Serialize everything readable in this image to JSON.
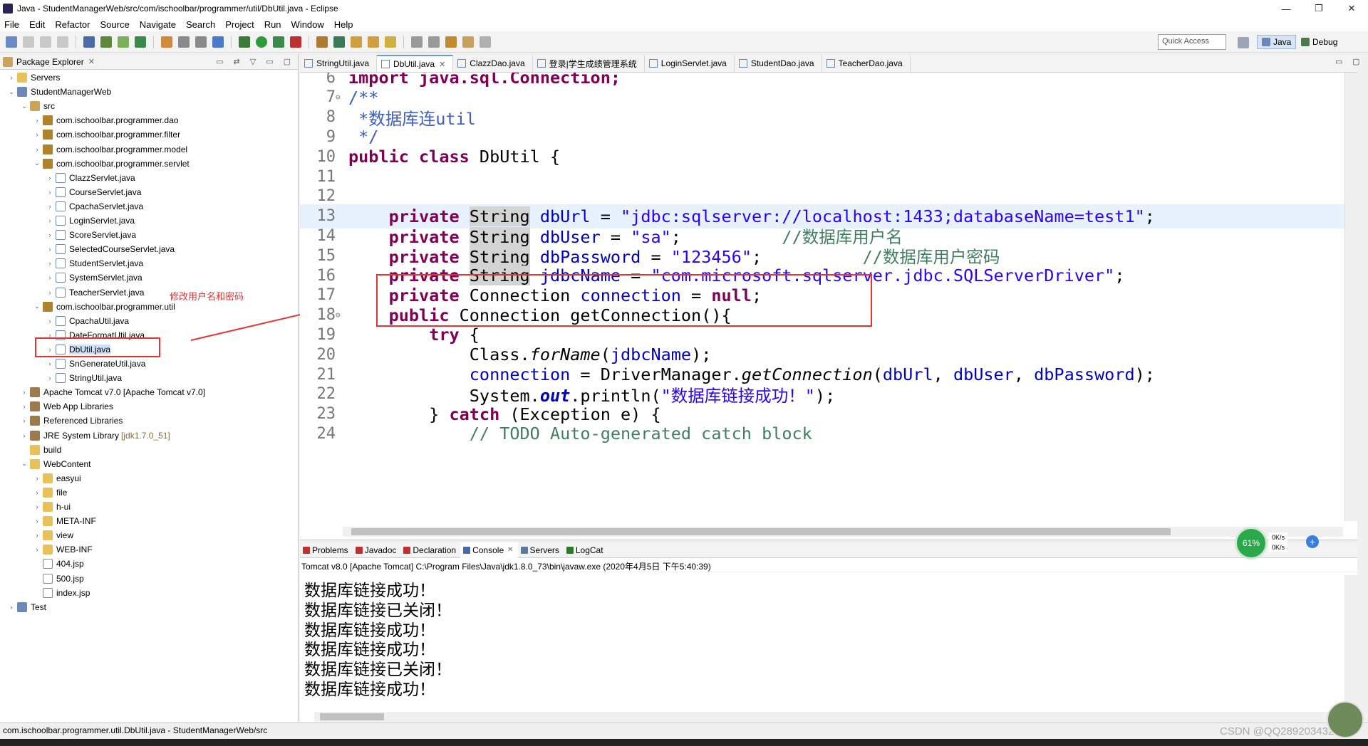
{
  "window": {
    "title": "Java - StudentManagerWeb/src/com/ischoolbar/programmer/util/DbUtil.java - Eclipse",
    "minimize": "—",
    "maximize": "❐",
    "close": "✕"
  },
  "menu": [
    "File",
    "Edit",
    "Refactor",
    "Source",
    "Navigate",
    "Search",
    "Project",
    "Run",
    "Window",
    "Help"
  ],
  "toolbar": {
    "quick_access": "Quick Access",
    "perspective_java": "Java",
    "perspective_debug": "Debug"
  },
  "package_explorer": {
    "tab_label": "Package Explorer",
    "tree": [
      {
        "label": "Servers",
        "icon": "folder-icon",
        "depth": 0,
        "arrow": "›"
      },
      {
        "label": "StudentManagerWeb",
        "icon": "project-icon",
        "depth": 0,
        "arrow": "⌄"
      },
      {
        "label": "src",
        "icon": "source-folder-icon",
        "depth": 1,
        "arrow": "⌄"
      },
      {
        "label": "com.ischoolbar.programmer.dao",
        "icon": "package-icon",
        "depth": 2,
        "arrow": "›"
      },
      {
        "label": "com.ischoolbar.programmer.filter",
        "icon": "package-icon",
        "depth": 2,
        "arrow": "›"
      },
      {
        "label": "com.ischoolbar.programmer.model",
        "icon": "package-icon",
        "depth": 2,
        "arrow": "›"
      },
      {
        "label": "com.ischoolbar.programmer.servlet",
        "icon": "package-icon",
        "depth": 2,
        "arrow": "⌄"
      },
      {
        "label": "ClazzServlet.java",
        "icon": "java-file-icon",
        "depth": 3,
        "arrow": "›"
      },
      {
        "label": "CourseServlet.java",
        "icon": "java-file-icon",
        "depth": 3,
        "arrow": "›"
      },
      {
        "label": "CpachaServlet.java",
        "icon": "java-file-icon",
        "depth": 3,
        "arrow": "›"
      },
      {
        "label": "LoginServlet.java",
        "icon": "java-file-icon",
        "depth": 3,
        "arrow": "›"
      },
      {
        "label": "ScoreServlet.java",
        "icon": "java-file-icon",
        "depth": 3,
        "arrow": "›"
      },
      {
        "label": "SelectedCourseServlet.java",
        "icon": "java-file-icon",
        "depth": 3,
        "arrow": "›"
      },
      {
        "label": "StudentServlet.java",
        "icon": "java-file-icon",
        "depth": 3,
        "arrow": "›"
      },
      {
        "label": "SystemServlet.java",
        "icon": "java-file-icon",
        "depth": 3,
        "arrow": "›"
      },
      {
        "label": "TeacherServlet.java",
        "icon": "java-file-icon",
        "depth": 3,
        "arrow": "›"
      },
      {
        "label": "com.ischoolbar.programmer.util",
        "icon": "package-icon",
        "depth": 2,
        "arrow": "⌄"
      },
      {
        "label": "CpachaUtil.java",
        "icon": "java-file-icon",
        "depth": 3,
        "arrow": "›"
      },
      {
        "label": "DateFormatUtil.java",
        "icon": "java-file-icon",
        "depth": 3,
        "arrow": "›"
      },
      {
        "label": "DbUtil.java",
        "icon": "java-file-icon",
        "depth": 3,
        "arrow": "›",
        "selected": true
      },
      {
        "label": "SnGenerateUtil.java",
        "icon": "java-file-icon",
        "depth": 3,
        "arrow": "›"
      },
      {
        "label": "StringUtil.java",
        "icon": "java-file-icon",
        "depth": 3,
        "arrow": "›"
      },
      {
        "label": "Apache Tomcat v7.0 [Apache Tomcat v7.0]",
        "icon": "library-icon",
        "depth": 1,
        "arrow": "›"
      },
      {
        "label": "Web App Libraries",
        "icon": "library-icon",
        "depth": 1,
        "arrow": "›"
      },
      {
        "label": "Referenced Libraries",
        "icon": "library-icon",
        "depth": 1,
        "arrow": "›"
      },
      {
        "label": "JRE System Library",
        "suffix": "[jdk1.7.0_51]",
        "icon": "library-icon",
        "depth": 1,
        "arrow": "›"
      },
      {
        "label": "build",
        "icon": "folder-icon",
        "depth": 1,
        "arrow": ""
      },
      {
        "label": "WebContent",
        "icon": "folder-icon",
        "depth": 1,
        "arrow": "⌄"
      },
      {
        "label": "easyui",
        "icon": "folder-icon",
        "depth": 2,
        "arrow": "›"
      },
      {
        "label": "file",
        "icon": "folder-icon",
        "depth": 2,
        "arrow": "›"
      },
      {
        "label": "h-ui",
        "icon": "folder-icon",
        "depth": 2,
        "arrow": "›"
      },
      {
        "label": "META-INF",
        "icon": "folder-icon",
        "depth": 2,
        "arrow": "›"
      },
      {
        "label": "view",
        "icon": "folder-icon",
        "depth": 2,
        "arrow": "›"
      },
      {
        "label": "WEB-INF",
        "icon": "folder-icon",
        "depth": 2,
        "arrow": "›"
      },
      {
        "label": "404.jsp",
        "icon": "jsp-file-icon",
        "depth": 2,
        "arrow": ""
      },
      {
        "label": "500.jsp",
        "icon": "jsp-file-icon",
        "depth": 2,
        "arrow": ""
      },
      {
        "label": "index.jsp",
        "icon": "jsp-file-icon",
        "depth": 2,
        "arrow": ""
      },
      {
        "label": "Test",
        "icon": "project-icon",
        "depth": 0,
        "arrow": "›"
      }
    ]
  },
  "annotation": {
    "text": "修改用户名和密码"
  },
  "editor": {
    "tabs": [
      {
        "label": "StringUtil.java",
        "active": false
      },
      {
        "label": "DbUtil.java",
        "active": true
      },
      {
        "label": "ClazzDao.java",
        "active": false
      },
      {
        "label": "登录|学生成绩管理系统",
        "active": false
      },
      {
        "label": "LoginServlet.java",
        "active": false
      },
      {
        "label": "StudentDao.java",
        "active": false
      },
      {
        "label": "TeacherDao.java",
        "active": false
      }
    ],
    "lines": [
      {
        "no": "6",
        "tokens": [
          {
            "t": "import java.sql.Connection;",
            "c": "kw"
          }
        ]
      },
      {
        "no": "7",
        "fold": true,
        "tokens": [
          {
            "t": "/**",
            "c": "doc"
          }
        ]
      },
      {
        "no": "8",
        "tokens": [
          {
            "t": " *数据库连util",
            "c": "doc"
          }
        ]
      },
      {
        "no": "9",
        "tokens": [
          {
            "t": " */",
            "c": "doc"
          }
        ]
      },
      {
        "no": "10",
        "tokens": [
          {
            "t": "public class",
            "c": "kw"
          },
          {
            "t": " DbUtil {",
            "c": ""
          }
        ]
      },
      {
        "no": "11",
        "tokens": []
      },
      {
        "no": "12",
        "tokens": []
      },
      {
        "no": "13",
        "current": true,
        "tokens": [
          {
            "t": "    ",
            "c": ""
          },
          {
            "t": "private",
            "c": "kw"
          },
          {
            "t": " ",
            "c": ""
          },
          {
            "t": "String",
            "c": "hl"
          },
          {
            "t": " ",
            "c": ""
          },
          {
            "t": "dbUrl",
            "c": "field"
          },
          {
            "t": " = ",
            "c": ""
          },
          {
            "t": "\"jdbc:sqlserver://localhost:1433;databaseName=test1\"",
            "c": "str"
          },
          {
            "t": ";",
            "c": ""
          }
        ]
      },
      {
        "no": "14",
        "tokens": [
          {
            "t": "    ",
            "c": ""
          },
          {
            "t": "private",
            "c": "kw"
          },
          {
            "t": " ",
            "c": ""
          },
          {
            "t": "String",
            "c": "hl"
          },
          {
            "t": " ",
            "c": ""
          },
          {
            "t": "dbUser",
            "c": "field"
          },
          {
            "t": " = ",
            "c": ""
          },
          {
            "t": "\"sa\"",
            "c": "str"
          },
          {
            "t": ";          ",
            "c": ""
          },
          {
            "t": "//数据库用户名",
            "c": "cm"
          }
        ]
      },
      {
        "no": "15",
        "tokens": [
          {
            "t": "    ",
            "c": ""
          },
          {
            "t": "private",
            "c": "kw"
          },
          {
            "t": " ",
            "c": ""
          },
          {
            "t": "String",
            "c": "hl"
          },
          {
            "t": " ",
            "c": ""
          },
          {
            "t": "dbPassword",
            "c": "field"
          },
          {
            "t": " = ",
            "c": ""
          },
          {
            "t": "\"123456\"",
            "c": "str"
          },
          {
            "t": ";          ",
            "c": ""
          },
          {
            "t": "//数据库用户密码",
            "c": "cm"
          }
        ]
      },
      {
        "no": "16",
        "tokens": [
          {
            "t": "    ",
            "c": ""
          },
          {
            "t": "private",
            "c": "kw"
          },
          {
            "t": " ",
            "c": ""
          },
          {
            "t": "String",
            "c": "hl"
          },
          {
            "t": " ",
            "c": ""
          },
          {
            "t": "jdbcName",
            "c": "field"
          },
          {
            "t": " = ",
            "c": ""
          },
          {
            "t": "\"com.microsoft.sqlserver.jdbc.SQLServerDriver\"",
            "c": "str"
          },
          {
            "t": ";",
            "c": ""
          }
        ]
      },
      {
        "no": "17",
        "tokens": [
          {
            "t": "    ",
            "c": ""
          },
          {
            "t": "private",
            "c": "kw"
          },
          {
            "t": " Connection ",
            "c": ""
          },
          {
            "t": "connection",
            "c": "field"
          },
          {
            "t": " = ",
            "c": ""
          },
          {
            "t": "null",
            "c": "kw"
          },
          {
            "t": ";",
            "c": ""
          }
        ]
      },
      {
        "no": "18",
        "fold": true,
        "tokens": [
          {
            "t": "    ",
            "c": ""
          },
          {
            "t": "public",
            "c": "kw"
          },
          {
            "t": " Connection getConnection(){",
            "c": ""
          }
        ]
      },
      {
        "no": "19",
        "tokens": [
          {
            "t": "        ",
            "c": ""
          },
          {
            "t": "try",
            "c": "kw"
          },
          {
            "t": " {",
            "c": ""
          }
        ]
      },
      {
        "no": "20",
        "tokens": [
          {
            "t": "            Class.",
            "c": ""
          },
          {
            "t": "forName",
            "c": "italic"
          },
          {
            "t": "(",
            "c": ""
          },
          {
            "t": "jdbcName",
            "c": "field"
          },
          {
            "t": ");",
            "c": ""
          }
        ]
      },
      {
        "no": "21",
        "tokens": [
          {
            "t": "            ",
            "c": ""
          },
          {
            "t": "connection",
            "c": "field"
          },
          {
            "t": " = DriverManager.",
            "c": ""
          },
          {
            "t": "getConnection",
            "c": "italic"
          },
          {
            "t": "(",
            "c": ""
          },
          {
            "t": "dbUrl",
            "c": "field"
          },
          {
            "t": ", ",
            "c": ""
          },
          {
            "t": "dbUser",
            "c": "field"
          },
          {
            "t": ", ",
            "c": ""
          },
          {
            "t": "dbPassword",
            "c": "field"
          },
          {
            "t": ");",
            "c": ""
          }
        ]
      },
      {
        "no": "22",
        "tokens": [
          {
            "t": "            System.",
            "c": ""
          },
          {
            "t": "out",
            "c": "field kw italic"
          },
          {
            "t": ".println(",
            "c": ""
          },
          {
            "t": "\"数据库链接成功！\"",
            "c": "str"
          },
          {
            "t": ");",
            "c": ""
          }
        ]
      },
      {
        "no": "23",
        "tokens": [
          {
            "t": "        } ",
            "c": ""
          },
          {
            "t": "catch",
            "c": "kw"
          },
          {
            "t": " (Exception e) {",
            "c": ""
          }
        ]
      },
      {
        "no": "24",
        "tokens": [
          {
            "t": "            // TODO Auto-generated catch block",
            "c": "cm"
          }
        ]
      }
    ]
  },
  "console": {
    "tabs": [
      {
        "label": "Problems",
        "active": false
      },
      {
        "label": "Javadoc",
        "active": false
      },
      {
        "label": "Declaration",
        "active": false
      },
      {
        "label": "Console",
        "active": true
      },
      {
        "label": "Servers",
        "active": false
      },
      {
        "label": "LogCat",
        "active": false
      }
    ],
    "description": "Tomcat v8.0  [Apache Tomcat] C:\\Program Files\\Java\\jdk1.8.0_73\\bin\\javaw.exe (2020年4月5日 下午5:40:39)",
    "lines": [
      "数据库链接成功！",
      "数据库链接已关闭！",
      "数据库链接成功！",
      "数据库链接成功！",
      "数据库链接已关闭！",
      "数据库链接成功！"
    ]
  },
  "net_widget": {
    "percent": "61%",
    "up": "0K/s",
    "down": "0K/s"
  },
  "status_bar": {
    "text": "com.ischoolbar.programmer.util.DbUtil.java - StudentManagerWeb/src"
  },
  "watermark": "CSDN @QQ2892034322"
}
